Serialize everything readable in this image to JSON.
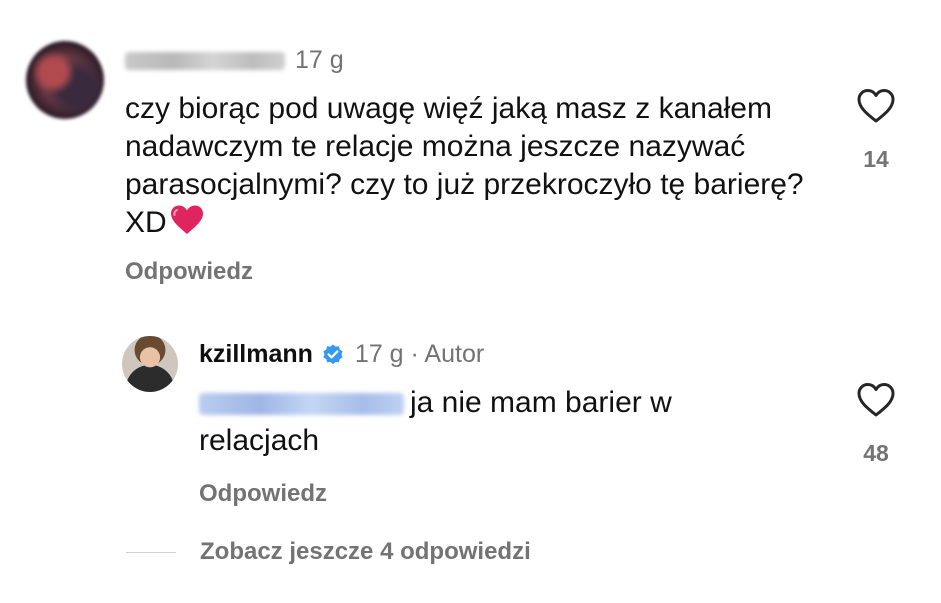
{
  "comments": [
    {
      "author_name": "",
      "time": "17 g",
      "text": "czy biorąc pod uwagę więź jaką masz z kanałem nadawczym te relacje można jeszcze nazywać parasocjalnymi? czy to już przekroczyło tę barierę? XD",
      "emoji": "red-heart",
      "reply_label": "Odpowiedz",
      "likes": "14"
    },
    {
      "author_name": "kzillmann",
      "verified": true,
      "time": "17 g · Autor",
      "mention": "",
      "text": "ja nie mam barier w relacjach",
      "reply_label": "Odpowiedz",
      "likes": "48"
    }
  ],
  "view_more": "Zobacz jeszcze 4 odpowiedzi",
  "colors": {
    "text": "#111111",
    "muted": "#737373",
    "verified": "#3897f0",
    "heart": "#e0245e"
  }
}
